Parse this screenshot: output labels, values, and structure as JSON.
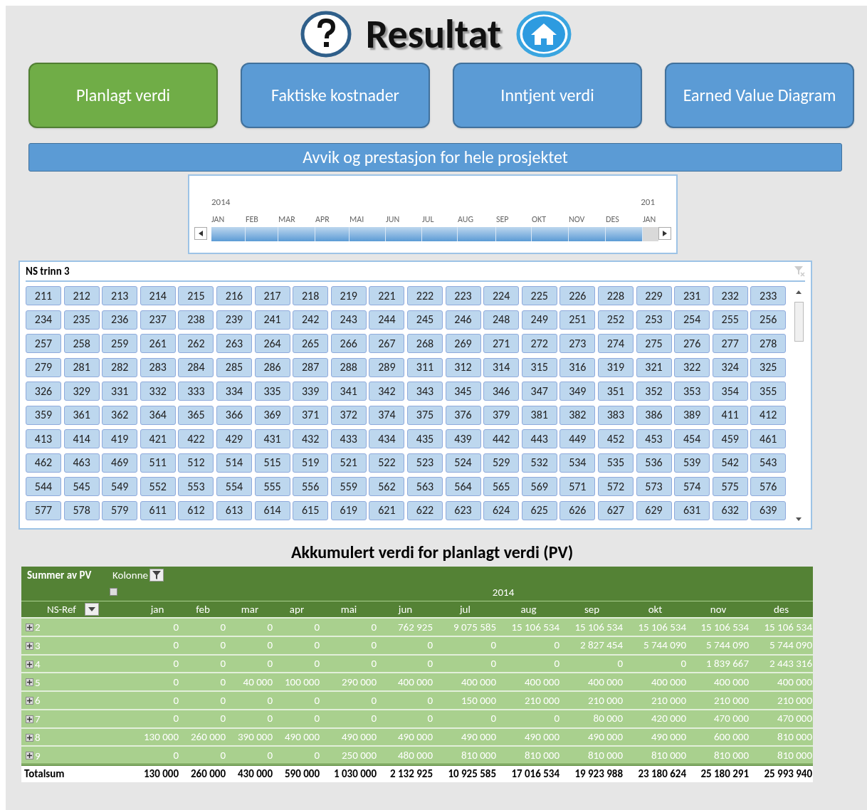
{
  "title": "Resultat",
  "nav_buttons": [
    {
      "label": "Planlagt verdi",
      "selected": true
    },
    {
      "label": "Faktiske kostnader",
      "selected": false
    },
    {
      "label": "Inntjent verdi",
      "selected": false
    },
    {
      "label": "Earned Value Diagram",
      "selected": false
    }
  ],
  "banner": "Avvik og prestasjon for hele prosjektet",
  "timeline": {
    "year_labels": [
      "2014",
      "201"
    ],
    "periods": [
      {
        "label": "JAN",
        "selected": true
      },
      {
        "label": "FEB",
        "selected": true
      },
      {
        "label": "MAR",
        "selected": true
      },
      {
        "label": "APR",
        "selected": true
      },
      {
        "label": "MAI",
        "selected": true
      },
      {
        "label": "JUN",
        "selected": true
      },
      {
        "label": "JUL",
        "selected": true
      },
      {
        "label": "AUG",
        "selected": true
      },
      {
        "label": "SEP",
        "selected": true
      },
      {
        "label": "OKT",
        "selected": true
      },
      {
        "label": "NOV",
        "selected": true
      },
      {
        "label": "DES",
        "selected": true
      },
      {
        "label": "JAN",
        "selected": false
      }
    ]
  },
  "slicer": {
    "title": "NS trinn 3",
    "items": [
      [
        "211",
        "212",
        "213",
        "214",
        "215",
        "216",
        "217",
        "218",
        "219",
        "221",
        "222",
        "223",
        "224",
        "225",
        "226",
        "228",
        "229",
        "231",
        "232",
        "233"
      ],
      [
        "234",
        "235",
        "236",
        "237",
        "238",
        "239",
        "241",
        "242",
        "243",
        "244",
        "245",
        "246",
        "248",
        "249",
        "251",
        "252",
        "253",
        "254",
        "255",
        "256"
      ],
      [
        "257",
        "258",
        "259",
        "261",
        "262",
        "263",
        "264",
        "265",
        "266",
        "267",
        "268",
        "269",
        "271",
        "272",
        "273",
        "274",
        "275",
        "276",
        "277",
        "278"
      ],
      [
        "279",
        "281",
        "282",
        "283",
        "284",
        "285",
        "286",
        "287",
        "288",
        "289",
        "311",
        "312",
        "314",
        "315",
        "316",
        "319",
        "321",
        "322",
        "324",
        "325"
      ],
      [
        "326",
        "329",
        "331",
        "332",
        "333",
        "334",
        "335",
        "339",
        "341",
        "342",
        "343",
        "345",
        "346",
        "347",
        "349",
        "351",
        "352",
        "353",
        "354",
        "355"
      ],
      [
        "359",
        "361",
        "362",
        "364",
        "365",
        "366",
        "369",
        "371",
        "372",
        "374",
        "375",
        "376",
        "379",
        "381",
        "382",
        "383",
        "386",
        "389",
        "411",
        "412"
      ],
      [
        "413",
        "414",
        "419",
        "421",
        "422",
        "429",
        "431",
        "432",
        "433",
        "434",
        "435",
        "439",
        "442",
        "443",
        "449",
        "452",
        "453",
        "454",
        "459",
        "461"
      ],
      [
        "462",
        "463",
        "469",
        "511",
        "512",
        "514",
        "515",
        "519",
        "521",
        "522",
        "523",
        "524",
        "529",
        "532",
        "534",
        "535",
        "536",
        "539",
        "542",
        "543"
      ],
      [
        "544",
        "545",
        "549",
        "552",
        "553",
        "554",
        "555",
        "556",
        "559",
        "562",
        "563",
        "564",
        "565",
        "569",
        "571",
        "572",
        "573",
        "574",
        "575",
        "576"
      ],
      [
        "577",
        "578",
        "579",
        "611",
        "612",
        "613",
        "614",
        "615",
        "619",
        "621",
        "622",
        "623",
        "624",
        "625",
        "626",
        "627",
        "629",
        "631",
        "632",
        "639"
      ]
    ]
  },
  "pivot": {
    "title": "Akkumulert verdi for planlagt verdi (PV)",
    "values_label": "Summer av PV",
    "column_label": "Kolonne",
    "year": "2014",
    "row_label": "NS-Ref",
    "columns": [
      "jan",
      "feb",
      "mar",
      "apr",
      "mai",
      "jun",
      "jul",
      "aug",
      "sep",
      "okt",
      "nov",
      "des"
    ],
    "rows": [
      {
        "ref": "2",
        "values": [
          "0",
          "0",
          "0",
          "0",
          "0",
          "762 925",
          "9 075 585",
          "15 106 534",
          "15 106 534",
          "15 106 534",
          "15 106 534",
          "15 106 534"
        ]
      },
      {
        "ref": "3",
        "values": [
          "0",
          "0",
          "0",
          "0",
          "0",
          "0",
          "0",
          "0",
          "2 827 454",
          "5 744 090",
          "5 744 090",
          "5 744 090"
        ]
      },
      {
        "ref": "4",
        "values": [
          "0",
          "0",
          "0",
          "0",
          "0",
          "0",
          "0",
          "0",
          "0",
          "0",
          "1 839 667",
          "2 443 316"
        ]
      },
      {
        "ref": "5",
        "values": [
          "0",
          "0",
          "40 000",
          "100 000",
          "290 000",
          "400 000",
          "400 000",
          "400 000",
          "400 000",
          "400 000",
          "400 000",
          "400 000"
        ]
      },
      {
        "ref": "6",
        "values": [
          "0",
          "0",
          "0",
          "0",
          "0",
          "0",
          "150 000",
          "210 000",
          "210 000",
          "210 000",
          "210 000",
          "210 000"
        ]
      },
      {
        "ref": "7",
        "values": [
          "0",
          "0",
          "0",
          "0",
          "0",
          "0",
          "0",
          "0",
          "80 000",
          "420 000",
          "470 000",
          "470 000"
        ]
      },
      {
        "ref": "8",
        "values": [
          "130 000",
          "260 000",
          "390 000",
          "490 000",
          "490 000",
          "490 000",
          "490 000",
          "490 000",
          "490 000",
          "490 000",
          "600 000",
          "810 000"
        ]
      },
      {
        "ref": "9",
        "values": [
          "0",
          "0",
          "0",
          "0",
          "250 000",
          "480 000",
          "810 000",
          "810 000",
          "810 000",
          "810 000",
          "810 000",
          "810 000"
        ]
      }
    ],
    "total": {
      "label": "Totalsum",
      "values": [
        "130 000",
        "260 000",
        "430 000",
        "590 000",
        "1 030 000",
        "2 132 925",
        "10 925 585",
        "17 016 534",
        "19 923 988",
        "23 180 624",
        "25 180 291",
        "25 993 940"
      ]
    }
  }
}
